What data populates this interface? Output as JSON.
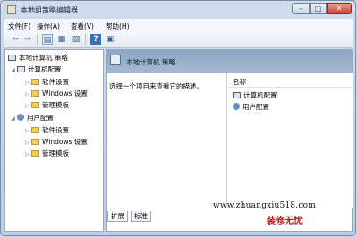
{
  "window": {
    "title": "本地组策略编辑器",
    "controls": {
      "minimize": "–",
      "maximize": "□",
      "close": "✕"
    }
  },
  "menu": [
    "文件(F)",
    "操作(A)",
    "查看(V)",
    "帮助(H)"
  ],
  "toolbar": {
    "icons": [
      "back-icon",
      "forward-icon",
      "show-hide-tree-icon",
      "view-icon",
      "export-icon",
      "help-icon",
      "properties-icon"
    ],
    "glyphs": [
      "⇦",
      "⇨",
      "▤",
      "▦",
      "▧",
      "?",
      "▣"
    ]
  },
  "tree": {
    "root": "本地计算机 策略",
    "computer_config": "计算机配置",
    "computer_children": [
      "软件设置",
      "Windows 设置",
      "管理模板"
    ],
    "user_config": "用户配置",
    "user_children": [
      "软件设置",
      "Windows 设置",
      "管理模板"
    ]
  },
  "detail": {
    "header": "本地计算机 策略",
    "description": "选择一个项目来查看它的描述。",
    "column_name": "名称",
    "items": [
      "计算机配置",
      "用户配置"
    ]
  },
  "tabs": [
    "扩展",
    "标准"
  ],
  "watermark": {
    "url": "www.zhuangxiu518.com",
    "brand": "装修无忧"
  }
}
